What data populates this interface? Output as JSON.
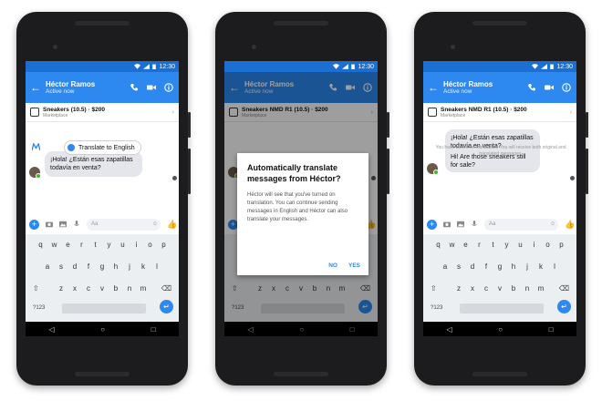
{
  "status": {
    "time": "12:30"
  },
  "header": {
    "name": "Héctor Ramos",
    "status": "Active now"
  },
  "phones": [
    {
      "listing": "Sneakers (10.5) · $200",
      "listing_sub": "Marketplace",
      "message": "¡Hola! ¿Están esas zapatillas todavía en venta?",
      "translate_chip": "Translate to English"
    },
    {
      "listing": "Sneakers NMD R1 (10.5) · $200",
      "listing_sub": "Marketplace",
      "dialog": {
        "title": "Automatically translate messages from Héctor?",
        "body": "Héctor will see that you've turned on translation. You can continue sending messages in English and Héctor can also translate your messages.",
        "no": "NO",
        "yes": "YES"
      }
    },
    {
      "listing": "Sneakers NMD R1 (10.5) · $200",
      "listing_sub": "Marketplace",
      "message_original": "¡Hola! ¿Están esas zapatillas todavía en venta?",
      "message_translated": "Hi! Are those sneakers still for sale?",
      "notice": "You have turned on translation. You will receive both original and translated messages."
    }
  ],
  "composer": {
    "placeholder": "Aa"
  },
  "keyboard": {
    "row1": [
      "q",
      "w",
      "e",
      "r",
      "t",
      "y",
      "u",
      "i",
      "o",
      "p"
    ],
    "row2": [
      "a",
      "s",
      "d",
      "f",
      "g",
      "h",
      "j",
      "k",
      "l"
    ],
    "row3": [
      "z",
      "x",
      "c",
      "v",
      "b",
      "n",
      "m"
    ],
    "symbols": "?123"
  },
  "colors": {
    "brand": "#2d88f0",
    "statusbar": "#1b6fd2"
  }
}
